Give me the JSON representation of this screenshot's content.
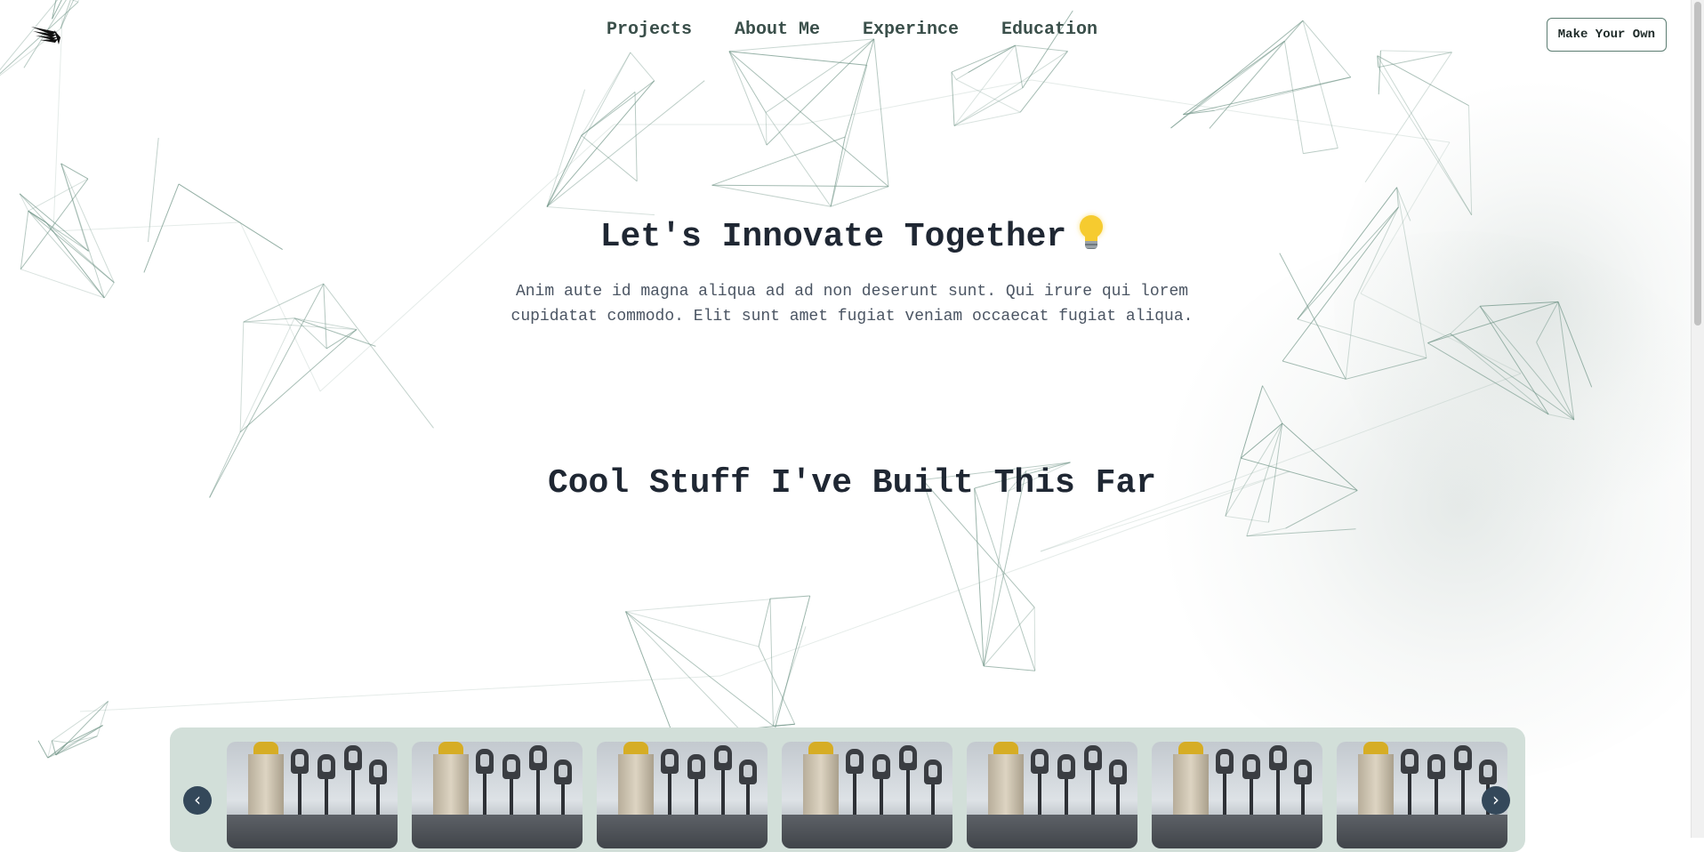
{
  "nav": {
    "links": [
      "Projects",
      "About Me",
      "Experince",
      "Education"
    ],
    "cta_label": "Make Your Own",
    "logo_icon": "bird-wing-icon"
  },
  "hero": {
    "title": "Let's Innovate Together",
    "title_icon": "lightbulb-icon",
    "description": "Anim aute id magna aliqua ad ad non deserunt sunt. Qui irure qui lorem cupidatat commodo. Elit sunt amet fugiat veniam occaecat fugiat aliqua."
  },
  "projects": {
    "title": "Cool Stuff I've Built This Far",
    "prev_label": "‹",
    "next_label": "›",
    "card_count": 7
  },
  "colors": {
    "accent": "#5c7d72",
    "carousel_bg": "#d2dfd9",
    "heading": "#1f2733",
    "arrow_bg": "#34485a"
  }
}
